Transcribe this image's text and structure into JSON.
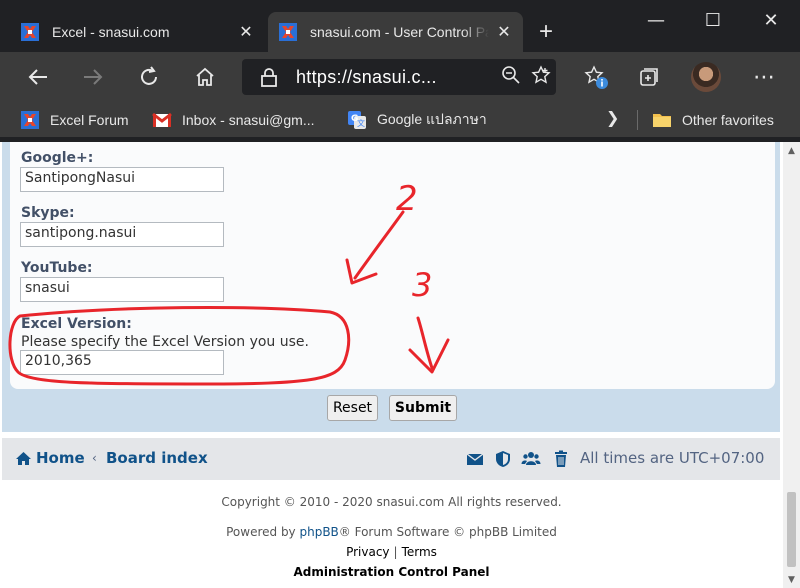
{
  "browser": {
    "tabs": [
      {
        "title": "Excel - snasui.com",
        "active": false
      },
      {
        "title": "snasui.com - User Control Panel",
        "active": true
      }
    ],
    "window_controls": {
      "minimize": "—",
      "maximize": "☐",
      "close": "✕"
    },
    "address": "https://snasui.com/ucp.php",
    "address_display": "https://snasui.c...",
    "favorites": [
      {
        "label": "Excel Forum",
        "icon": "snasui-icon"
      },
      {
        "label": "Inbox - snasui@gm...",
        "icon": "gmail-icon"
      },
      {
        "label": "Google แปลภาษา",
        "icon": "google-translate-icon"
      }
    ],
    "other_favorites": "Other favorites"
  },
  "form": {
    "fields": [
      {
        "label": "Google+:",
        "value": "SantipongNasui"
      },
      {
        "label": "Skype:",
        "value": "santipong.nasui"
      },
      {
        "label": "YouTube:",
        "value": "snasui"
      },
      {
        "label": "Excel Version:",
        "description": "Please specify the Excel Version you use.",
        "value": "2010,365"
      }
    ],
    "reset_label": "Reset",
    "submit_label": "Submit"
  },
  "navbar": {
    "home": "Home",
    "board_index": "Board index",
    "timezone": "All times are UTC+07:00"
  },
  "footer": {
    "copyright": "Copyright © 2010 - 2020 snasui.com All rights reserved.",
    "powered_prefix": "Powered by ",
    "phpbb": "phpBB",
    "powered_suffix": "® Forum Software © phpBB Limited",
    "privacy": "Privacy",
    "separator": "|",
    "terms": "Terms",
    "admin_panel": "Administration Control Panel"
  },
  "annotations": {
    "step2": "2",
    "step3": "3"
  },
  "colors": {
    "annotation": "#e8252b",
    "link": "#105289"
  }
}
